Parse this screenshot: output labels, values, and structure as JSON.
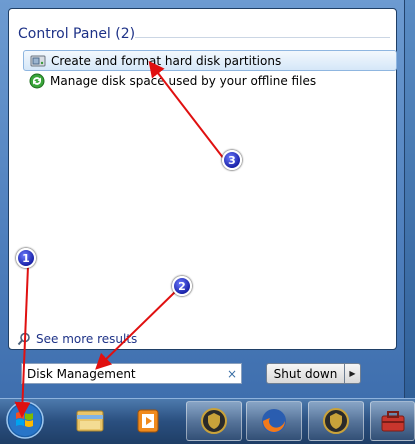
{
  "start_menu": {
    "section_header": "Control Panel (2)",
    "results": [
      {
        "label": "Create and format hard disk partitions",
        "icon": "disk-partition-icon",
        "selected": true
      },
      {
        "label": "Manage disk space used by your offline files",
        "icon": "sync-center-icon",
        "selected": false
      }
    ],
    "see_more": "See more results",
    "search": {
      "value": "Disk Management",
      "clear_glyph": "×"
    },
    "shutdown": {
      "label": "Shut down",
      "arrow": "▶"
    }
  },
  "taskbar": {
    "items": [
      {
        "icon": "windows-start-orb-icon"
      },
      {
        "icon": "file-explorer-icon"
      },
      {
        "icon": "media-player-icon"
      },
      {
        "icon": "security-badge-icon"
      },
      {
        "icon": "firefox-icon"
      },
      {
        "icon": "security-badge-icon"
      },
      {
        "icon": "toolbox-icon"
      }
    ]
  },
  "annotations": [
    {
      "number": "1"
    },
    {
      "number": "2"
    },
    {
      "number": "3"
    }
  ],
  "colors": {
    "annotation_arrow": "#e01010",
    "marker": "#1a22a8",
    "header_text": "#1e3287"
  }
}
